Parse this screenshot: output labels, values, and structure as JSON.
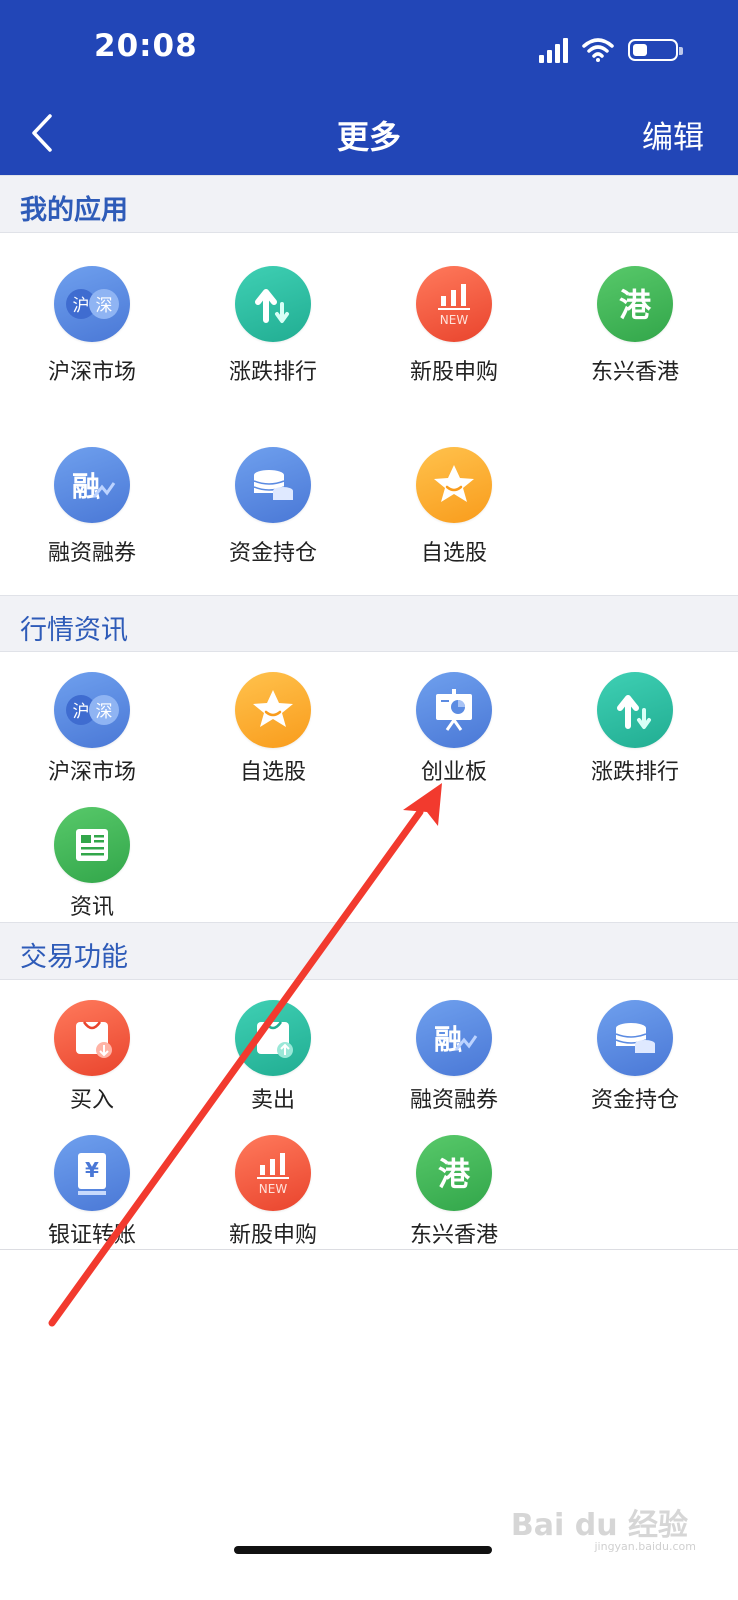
{
  "status_bar": {
    "time": "20:08",
    "battery_level_percent": 35
  },
  "nav": {
    "title": "更多",
    "edit_label": "编辑"
  },
  "sections": [
    {
      "title": "我的应用",
      "items": [
        {
          "label": "沪深市场",
          "icon": "hushen-market-icon",
          "color": "#5b8be2"
        },
        {
          "label": "涨跌排行",
          "icon": "rise-fall-ranking-icon",
          "color": "#2cbfa3"
        },
        {
          "label": "新股申购",
          "icon": "new-stock-subscription-icon",
          "color": "#f2583b"
        },
        {
          "label": "东兴香港",
          "icon": "hong-kong-icon",
          "color": "#3fb556"
        },
        {
          "label": "融资融券",
          "icon": "margin-trading-icon",
          "color": "#5b8be2"
        },
        {
          "label": "资金持仓",
          "icon": "funds-position-icon",
          "color": "#5b8be2"
        },
        {
          "label": "自选股",
          "icon": "watchlist-star-icon",
          "color": "#fbab2e"
        }
      ]
    },
    {
      "title": "行情资讯",
      "items": [
        {
          "label": "沪深市场",
          "icon": "hushen-market-icon",
          "color": "#5b8be2"
        },
        {
          "label": "自选股",
          "icon": "watchlist-star-icon",
          "color": "#fbab2e"
        },
        {
          "label": "创业板",
          "icon": "gem-board-icon",
          "color": "#5b8be2"
        },
        {
          "label": "涨跌排行",
          "icon": "rise-fall-ranking-icon",
          "color": "#2cbfa3"
        },
        {
          "label": "资讯",
          "icon": "news-icon",
          "color": "#3fb556"
        }
      ]
    },
    {
      "title": "交易功能",
      "items": [
        {
          "label": "买入",
          "icon": "buy-bag-icon",
          "color": "#f2583b"
        },
        {
          "label": "卖出",
          "icon": "sell-icon",
          "color": "#2cbfa3"
        },
        {
          "label": "融资融券",
          "icon": "margin-trading-icon",
          "color": "#5b8be2"
        },
        {
          "label": "资金持仓",
          "icon": "funds-position-icon",
          "color": "#5b8be2"
        },
        {
          "label": "银证转账",
          "icon": "bank-transfer-icon",
          "color": "#5b8be2"
        },
        {
          "label": "新股申购",
          "icon": "new-stock-subscription-icon",
          "color": "#f2583b"
        },
        {
          "label": "东兴香港",
          "icon": "hong-kong-icon",
          "color": "#3fb556"
        }
      ]
    }
  ],
  "icon_glyphs": {
    "hu": "沪",
    "shen": "深",
    "new": "NEW",
    "gang": "港",
    "rong": "融",
    "yen": "¥"
  },
  "annotation": {
    "type": "red-arrow",
    "color": "#f23a2e",
    "points_to": "创业板"
  },
  "watermark": {
    "brand": "Bai du 经验",
    "domain": "jingyan.baidu.com"
  }
}
